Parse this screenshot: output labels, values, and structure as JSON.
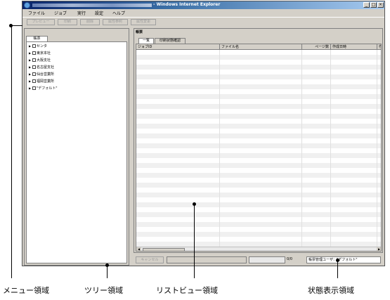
{
  "window": {
    "title": "- Windows Internet Explorer",
    "controls": [
      "_",
      "□",
      "×"
    ]
  },
  "menu": {
    "items": [
      "ファイル",
      "ジョブ",
      "実行",
      "設定",
      "ヘルプ"
    ]
  },
  "toolbar": {
    "buttons": [
      "プレビュー",
      "印刷",
      "削除",
      "属性参照",
      "属性変更"
    ]
  },
  "tree": {
    "tab_label": "帳票",
    "items": [
      "センタ",
      "東京本社",
      "大阪支社",
      "名古屋支社",
      "仙台営業所",
      "福岡営業所",
      "\"デフォルト\""
    ]
  },
  "list": {
    "title": "帳票",
    "tabs": [
      "一覧",
      "印刷状態確認"
    ],
    "columns": [
      "ジョブID",
      "ファイル名",
      "ページ数",
      "作成日時",
      "作"
    ]
  },
  "status": {
    "cancel_label": "キャンセル",
    "progress_text": "0/0",
    "user_text": "帳票管理ユーザ：\"デフォルト\""
  },
  "annotations": {
    "menu_area": "メニュー領域",
    "tree_area": "ツリー領域",
    "list_area": "リストビュー領域",
    "status_area": "状態表示領域"
  }
}
